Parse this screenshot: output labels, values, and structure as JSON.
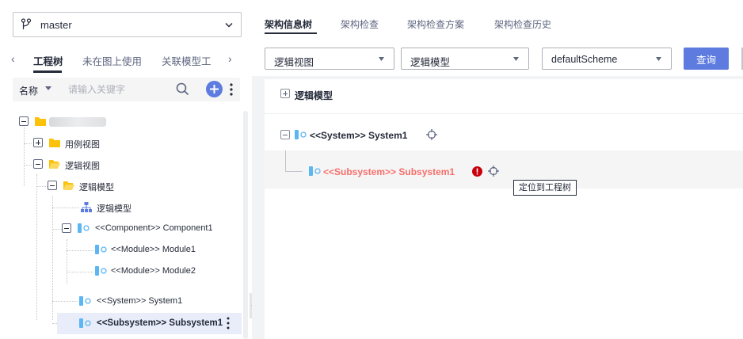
{
  "left": {
    "branch": "master",
    "tabs": [
      "工程树",
      "未在图上使用",
      "关联模型工  "
    ],
    "filter": {
      "field": "名称",
      "placeholder": "请输入关键字"
    },
    "tree": [
      {
        "label": ""
      },
      {
        "label": "用例视图"
      },
      {
        "label": "逻辑视图"
      },
      {
        "label": "逻辑模型"
      },
      {
        "label": "逻辑模型"
      },
      {
        "label": "<<Component>> Component1"
      },
      {
        "label": "<<Module>> Module1"
      },
      {
        "label": "<<Module>> Module2"
      },
      {
        "label": "<<System>> System1"
      },
      {
        "label": "<<Subsystem>> Subsystem1"
      }
    ]
  },
  "right": {
    "tabs": [
      "架构信息树",
      "架构检查",
      "架构检查方案",
      "架构检查历史"
    ],
    "selects": [
      "逻辑视图",
      "逻辑模型",
      "defaultScheme"
    ],
    "query_label": "查询",
    "canvas": {
      "root_label": "逻辑模型",
      "system_label": "<<System>> System1",
      "subsystem_label": "<<Subsystem>> Subsystem1",
      "tooltip": "定位到工程树"
    }
  },
  "colors": {
    "primary": "#5e7ce0",
    "error": "#f66f6a",
    "folder": "#fac20a",
    "node_icon": "#5cb6f2"
  }
}
